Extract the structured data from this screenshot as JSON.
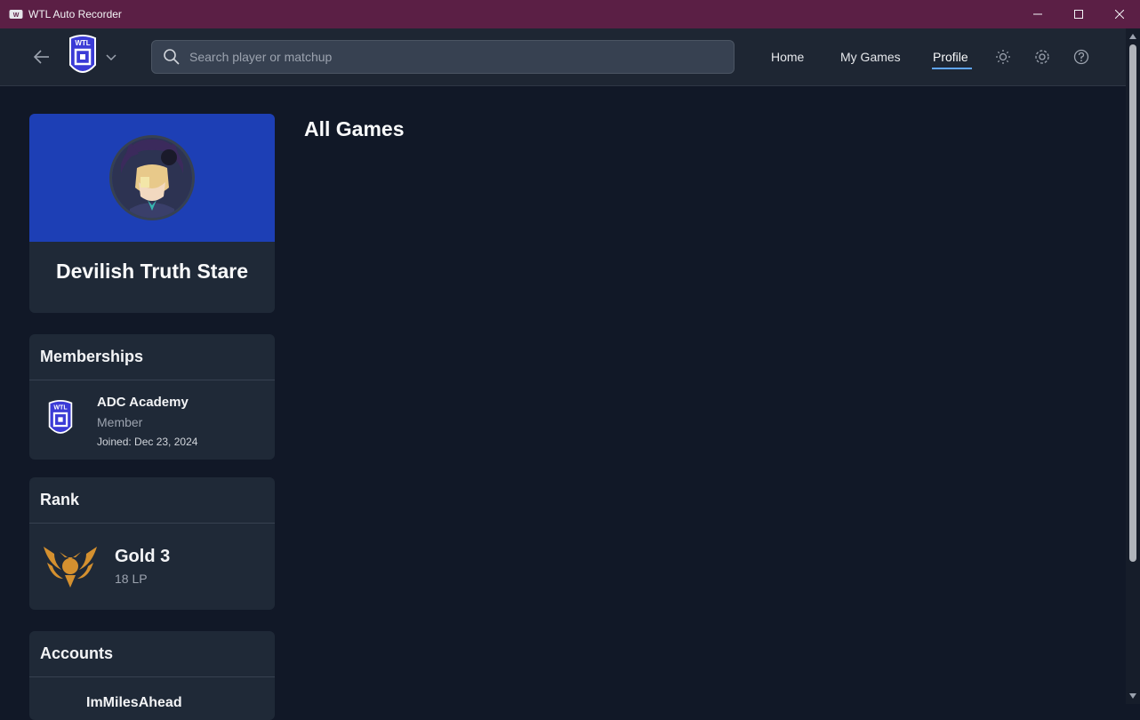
{
  "window": {
    "title": "WTL Auto Recorder",
    "controls": [
      "minimize",
      "maximize",
      "close"
    ]
  },
  "navbar": {
    "search_placeholder": "Search player or matchup",
    "links": [
      {
        "label": "Home",
        "active": false
      },
      {
        "label": "My Games",
        "active": false
      },
      {
        "label": "Profile",
        "active": true
      }
    ],
    "logo_text": "WTL",
    "icons": [
      "back-arrow-icon",
      "chevron-down-icon",
      "search-icon",
      "sun-icon",
      "gear-icon",
      "help-icon"
    ]
  },
  "profile": {
    "name": "Devilish Truth Stare",
    "banner_color": "#1d3fb5"
  },
  "memberships": {
    "title": "Memberships",
    "items": [
      {
        "name": "ADC Academy",
        "role": "Member",
        "joined": "Joined: Dec 23, 2024"
      }
    ]
  },
  "rank": {
    "title": "Rank",
    "tier": "Gold 3",
    "lp": "18 LP",
    "emblem_color": "#d4902f"
  },
  "accounts": {
    "title": "Accounts",
    "items": [
      {
        "name": "ImMilesAhead"
      }
    ]
  },
  "main": {
    "title": "All Games"
  },
  "colors": {
    "titlebar": "#5b1f45",
    "navbar": "#1e2633",
    "background": "#111827",
    "card": "#1f2937",
    "accent": "#60a5fa",
    "logo": "#3b3bd6"
  }
}
